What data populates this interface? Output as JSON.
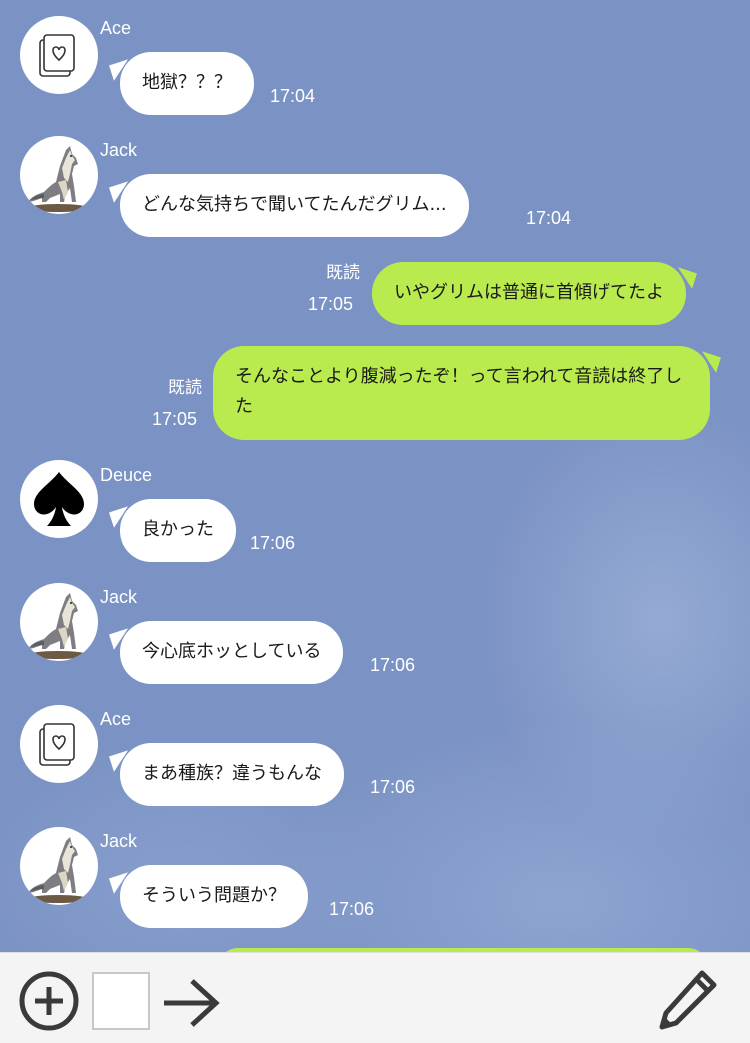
{
  "messages": [
    {
      "sender": "Ace",
      "text": "地獄？？？",
      "time": "17:04",
      "avatar": "heart-card-icon"
    },
    {
      "sender": "Jack",
      "text": "どんな気持ちで聞いてたんだグリム...",
      "time": "17:04",
      "avatar": "wolf-icon"
    },
    {
      "read": "既読",
      "text": "いやグリムは普通に首傾げてたよ",
      "time": "17:05"
    },
    {
      "read": "既読",
      "text": "そんなことより腹減ったぞ！って言われて音読は終了した",
      "time": "17:05"
    },
    {
      "sender": "Deuce",
      "text": "良かった",
      "time": "17:06",
      "avatar": "spade-icon"
    },
    {
      "sender": "Jack",
      "text": "今心底ホッとしている",
      "time": "17:06",
      "avatar": "wolf-icon"
    },
    {
      "sender": "Ace",
      "text": "まあ種族？違うもんな",
      "time": "17:06",
      "avatar": "heart-card-icon"
    },
    {
      "sender": "Jack",
      "text": "そういう問題か？",
      "time": "17:06",
      "avatar": "wolf-icon"
    }
  ],
  "toolbar": {
    "icons": [
      "add-circle-icon",
      "image-square-icon",
      "arrow-right-icon",
      "pencil-icon"
    ]
  },
  "colors": {
    "background": "#7b93c4",
    "incoming_bubble": "#ffffff",
    "outgoing_bubble": "#b9ea4e",
    "toolbar": "#f4f4f4"
  }
}
